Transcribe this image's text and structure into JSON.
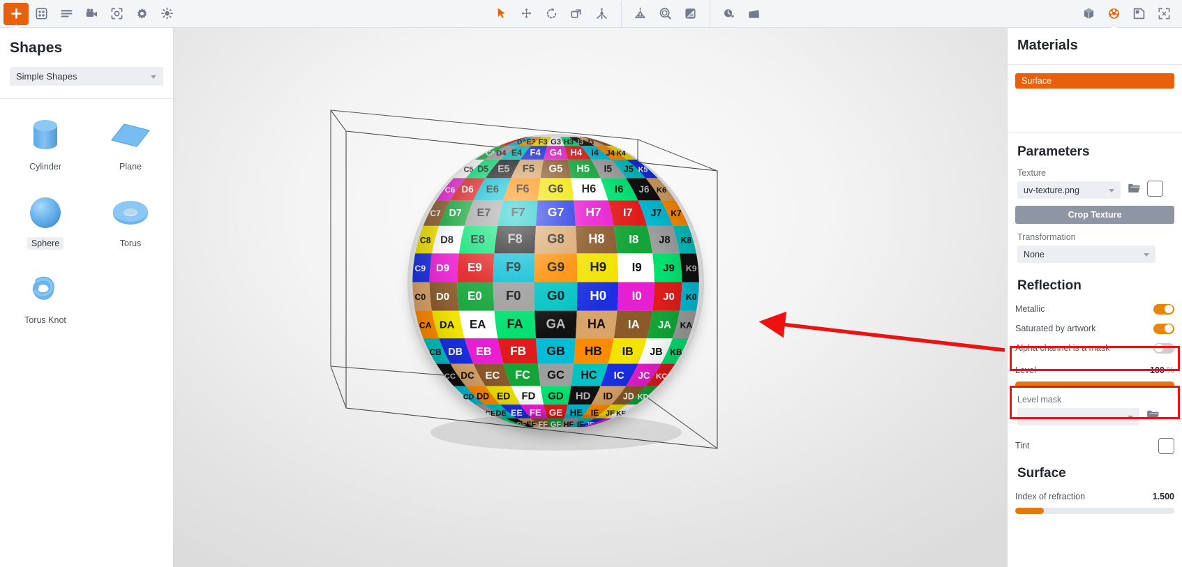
{
  "toolbar": {
    "left_items": [
      {
        "name": "add-icon",
        "label": "Add",
        "state": "active"
      },
      {
        "name": "grid-icon",
        "label": "Library",
        "state": "normal"
      },
      {
        "name": "list-icon",
        "label": "Layers",
        "state": "normal"
      },
      {
        "name": "camera-icon",
        "label": "Camera",
        "state": "normal"
      },
      {
        "name": "focus-icon",
        "label": "Environment",
        "state": "normal"
      },
      {
        "name": "gear-icon",
        "label": "Settings",
        "state": "normal"
      },
      {
        "name": "light-icon",
        "label": "Light",
        "state": "normal"
      }
    ],
    "center_items": [
      {
        "name": "cursor-select-icon",
        "label": "Select",
        "state": "active-plain"
      },
      {
        "name": "move-icon",
        "label": "Move",
        "state": "normal"
      },
      {
        "name": "rotate-icon",
        "label": "Rotate",
        "state": "normal"
      },
      {
        "name": "scale-icon",
        "label": "Scale",
        "state": "normal"
      },
      {
        "name": "transform-3d-icon",
        "label": "Transform",
        "state": "normal"
      }
    ],
    "center_items_2": [
      {
        "name": "perspective-icon",
        "label": "Perspective",
        "state": "normal"
      },
      {
        "name": "zoom-object-icon",
        "label": "Zoom to object",
        "state": "normal"
      },
      {
        "name": "shading-icon",
        "label": "Shading",
        "state": "normal"
      }
    ],
    "center_items_3": [
      {
        "name": "stopwatch-icon",
        "label": "Timeline",
        "state": "normal"
      },
      {
        "name": "clapperboard-icon",
        "label": "Animation",
        "state": "normal"
      }
    ],
    "right_items": [
      {
        "name": "cube-icon",
        "label": "Geometry",
        "state": "normal"
      },
      {
        "name": "material-ball-icon",
        "label": "Materials",
        "state": "active-plain"
      },
      {
        "name": "image-icon",
        "label": "Background",
        "state": "normal"
      },
      {
        "name": "fullscreen-icon",
        "label": "Fullscreen",
        "state": "normal"
      }
    ]
  },
  "left_panel": {
    "title": "Shapes",
    "category_select": {
      "value": "Simple Shapes"
    },
    "shapes": [
      {
        "label": "Cylinder",
        "icon": "cylinder-icon",
        "selected": false
      },
      {
        "label": "Plane",
        "icon": "plane-icon",
        "selected": false
      },
      {
        "label": "Sphere",
        "icon": "sphere-icon",
        "selected": true
      },
      {
        "label": "Torus",
        "icon": "torus-icon",
        "selected": false
      },
      {
        "label": "Torus Knot",
        "icon": "torus-knot-icon",
        "selected": false
      }
    ]
  },
  "viewport": {
    "object": "sphere",
    "texture_name": "uv-texture.png",
    "uv_columns": [
      "C",
      "D",
      "E",
      "F",
      "G",
      "H",
      "I",
      "J",
      "K"
    ],
    "uv_rows": [
      "3",
      "4",
      "5",
      "6",
      "7",
      "8",
      "9",
      "0",
      "A",
      "B",
      "C",
      "D",
      "E",
      "F"
    ],
    "visible_cells": [
      "F4",
      "G4",
      "H4",
      "I4",
      "D5",
      "E5",
      "F5",
      "G5",
      "H5",
      "I5",
      "J5",
      "D6",
      "E6",
      "F6",
      "G6",
      "H6",
      "I6",
      "J6",
      "D7",
      "E7",
      "F7",
      "G7",
      "H7",
      "I7",
      "J7",
      "D8",
      "E8",
      "F8",
      "G8",
      "H8",
      "I8",
      "J8",
      "D9",
      "E9",
      "F9",
      "G9",
      "H9",
      "I9",
      "J9",
      "D0",
      "E0",
      "F0",
      "G0",
      "H0",
      "I0",
      "J0",
      "DA",
      "EA",
      "FA",
      "GA",
      "HA",
      "IA",
      "JA",
      "DB",
      "EB",
      "FB",
      "GB",
      "HB",
      "IB",
      "JB",
      "DC",
      "EC",
      "FC",
      "GC",
      "HC",
      "IC",
      "JC",
      "FD",
      "GD",
      "HD",
      "ID",
      "FE",
      "GE",
      "HE",
      "IE"
    ],
    "bounding_box_visible": true
  },
  "right_panel": {
    "title": "Materials",
    "materials": [
      {
        "label": "Surface",
        "selected": true
      }
    ],
    "parameters": {
      "title": "Parameters",
      "texture_label": "Texture",
      "texture_value": "uv-texture.png",
      "browse_icon": "folder-icon",
      "color_swatch": "color-swatch",
      "crop_button": "Crop Texture",
      "transformation_label": "Transformation",
      "transformation_value": "None"
    },
    "reflection": {
      "title": "Reflection",
      "metallic_label": "Metallic",
      "metallic_on": true,
      "saturated_label": "Saturated by artwork",
      "saturated_on": true,
      "alpha_mask_label": "Alpha channel is a mask",
      "alpha_mask_on": false,
      "level_label": "Level",
      "level_value": "100",
      "level_unit": "%",
      "level_percent": 100,
      "level_mask_label": "Level mask",
      "level_mask_value": "",
      "level_mask_browse_icon": "folder-icon",
      "tint_label": "Tint"
    },
    "surface": {
      "title": "Surface",
      "ior_label": "Index of refraction",
      "ior_value": "1.500",
      "ior_percent": 18
    }
  },
  "annotations": {
    "boxes": [
      {
        "name": "saturated-by-artwork-highlight"
      },
      {
        "name": "level-highlight"
      }
    ],
    "arrow": {
      "name": "callout-arrow",
      "color": "#ef1111"
    }
  },
  "colors": {
    "accent_orange": "#e8600b",
    "toggle_orange": "#e8850b",
    "slider_orange": "#e8760b",
    "annotation_red": "#ef1111",
    "toolbar_bg": "#f4f5f7",
    "panel_bg": "#ffffff",
    "icon_gray": "#727c8c",
    "shape_blue": "#6cb4ee"
  }
}
